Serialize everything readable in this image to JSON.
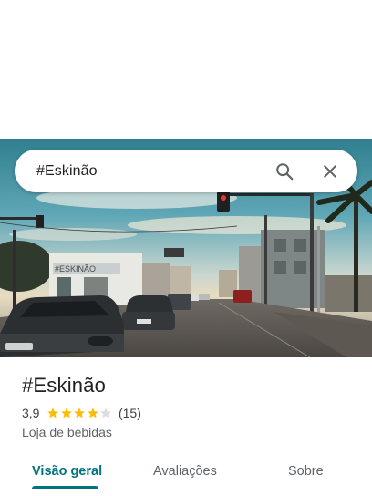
{
  "search": {
    "query": "#Eskinão",
    "search_icon": "search-icon",
    "close_icon": "close-icon"
  },
  "hero": {
    "photo_sign_text": "#ESKINÃO"
  },
  "place": {
    "name": "#Eskinão",
    "rating": "3,9",
    "rating_value": 3.9,
    "stars_filled": 4,
    "stars_total": 5,
    "review_count": "(15)",
    "category": "Loja de bebidas"
  },
  "tabs": [
    {
      "label": "Visão geral",
      "active": true
    },
    {
      "label": "Avaliações",
      "active": false
    },
    {
      "label": "Sobre",
      "active": false
    }
  ],
  "colors": {
    "accent": "#00737e",
    "star": "#fbbc04",
    "star_empty": "#dadce0"
  }
}
